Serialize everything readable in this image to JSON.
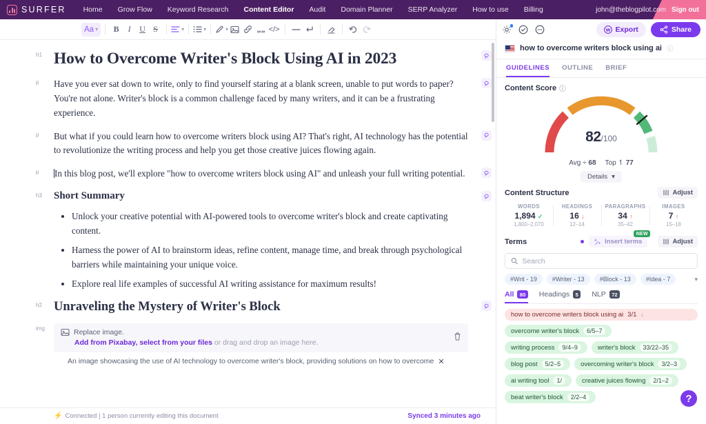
{
  "topnav": {
    "brand": "SURFER",
    "links": [
      {
        "label": "Home",
        "active": false
      },
      {
        "label": "Grow Flow",
        "active": false
      },
      {
        "label": "Keyword Research",
        "active": false
      },
      {
        "label": "Content Editor",
        "active": true
      },
      {
        "label": "Audit",
        "active": false
      },
      {
        "label": "Domain Planner",
        "active": false
      },
      {
        "label": "SERP Analyzer",
        "active": false
      },
      {
        "label": "How to use",
        "active": false
      },
      {
        "label": "Billing",
        "active": false
      }
    ],
    "email": "john@theblogpilot.com",
    "signout": "Sign out"
  },
  "toolbar": {
    "font_label": "Aa",
    "bold": "B",
    "italic": "I",
    "underline": "U",
    "strike": "S"
  },
  "document": {
    "blocks": [
      {
        "tag": "h1",
        "type": "h1",
        "text": "How to Overcome Writer's Block Using AI in 2023"
      },
      {
        "tag": "p",
        "type": "p",
        "text": "Have you ever sat down to write, only to find yourself staring at a blank screen, unable to put words to paper? You're not alone. Writer's block is a common challenge faced by many writers, and it can be a frustrating experience."
      },
      {
        "tag": "p",
        "type": "p",
        "text": "But what if you could learn how to overcome writers block using AI? That's right, AI technology has the potential to revolutionize the writing process and help you get those creative juices flowing again."
      },
      {
        "tag": "p",
        "type": "p",
        "text": "In this blog post, we'll explore \"how to overcome writers block using AI\" and unleash your full writing potential."
      },
      {
        "tag": "h3",
        "type": "h3",
        "text": "Short Summary"
      },
      {
        "tag": "",
        "type": "ul",
        "items": [
          "Unlock your creative potential with AI-powered tools to overcome writer's block and create captivating content.",
          "Harness the power of AI to brainstorm ideas, refine content, manage time, and break through psychological barriers while maintaining your unique voice.",
          "Explore real life examples of successful AI writing assistance for maximum results!"
        ]
      },
      {
        "tag": "h2",
        "type": "h2",
        "text": "Unraveling the Mystery of Writer's Block"
      }
    ],
    "image_block": {
      "gutter": "img",
      "replace_label": "Replace image.",
      "link_pixabay": "Add from Pixabay, select from your files",
      "drag_text": " or drag and drop an image here.",
      "alt_text": "An image showcasing the use of AI technology to overcome writer's block, providing solutions on how to overcome"
    }
  },
  "statusbar": {
    "connection": "Connected | 1 person currently editing this document",
    "sync": "Synced 3 minutes ago"
  },
  "panel": {
    "export_label": "Export",
    "share_label": "Share",
    "keyword": "how to overcome writers block using ai",
    "tabs": [
      {
        "label": "GUIDELINES",
        "active": true
      },
      {
        "label": "OUTLINE",
        "active": false
      },
      {
        "label": "BRIEF",
        "active": false
      }
    ],
    "content_score": {
      "title": "Content Score",
      "score": "82",
      "out_of": "/100",
      "avg_label": "Avg",
      "avg_value": "68",
      "top_label": "Top",
      "top_value": "77",
      "details_label": "Details",
      "needle_angle": 52,
      "colors": {
        "red": "#e04a4a",
        "orange": "#e8972e",
        "green": "#52b878",
        "track": "#cdecd8"
      }
    },
    "content_structure": {
      "title": "Content Structure",
      "adjust_label": "Adjust",
      "stats": [
        {
          "label": "WORDS",
          "value": "1,894",
          "marker": "ok",
          "range": "1,800–2,070"
        },
        {
          "label": "HEADINGS",
          "value": "16",
          "marker": "down",
          "range": "12–14"
        },
        {
          "label": "PARAGRAPHS",
          "value": "34",
          "marker": "up",
          "range": "35–42"
        },
        {
          "label": "IMAGES",
          "value": "7",
          "marker": "up",
          "range": "15–18"
        }
      ]
    },
    "terms": {
      "title": "Terms",
      "insert_label": "Insert terms",
      "new_badge": "NEW",
      "adjust_label": "Adjust",
      "search_placeholder": "Search",
      "hashes": [
        "#Writ - 19",
        "#Writer - 13",
        "#Block - 13",
        "#Idea - 7"
      ],
      "filter_tabs": [
        {
          "label": "All",
          "count": "80",
          "active": true
        },
        {
          "label": "Headings",
          "count": "5",
          "active": false
        },
        {
          "label": "NLP",
          "count": "72",
          "active": false
        }
      ],
      "list": [
        {
          "text": "how to overcome writers block using ai",
          "count": "3/1",
          "state": "red",
          "arrow": "↓",
          "full": true
        },
        {
          "text": "overcome writer's block",
          "count": "6/5–7",
          "state": "green",
          "arrow": ""
        },
        {
          "text": "writing process",
          "count": "9/4–9",
          "state": "green",
          "arrow": ""
        },
        {
          "text": "writer's block",
          "count": "33/22–35",
          "state": "green",
          "arrow": ""
        },
        {
          "text": "blog post",
          "count": "5/2–5",
          "state": "green",
          "arrow": ""
        },
        {
          "text": "overcoming writer's block",
          "count": "3/2–3",
          "state": "green",
          "arrow": ""
        },
        {
          "text": "ai writing tool",
          "count": "1/",
          "state": "green",
          "arrow": ""
        },
        {
          "text": "creative juices flowing",
          "count": "2/1–2",
          "state": "green",
          "arrow": ""
        },
        {
          "text": "beat writer's block",
          "count": "2/2–4",
          "state": "green",
          "arrow": ""
        }
      ]
    },
    "help_label": "?"
  }
}
